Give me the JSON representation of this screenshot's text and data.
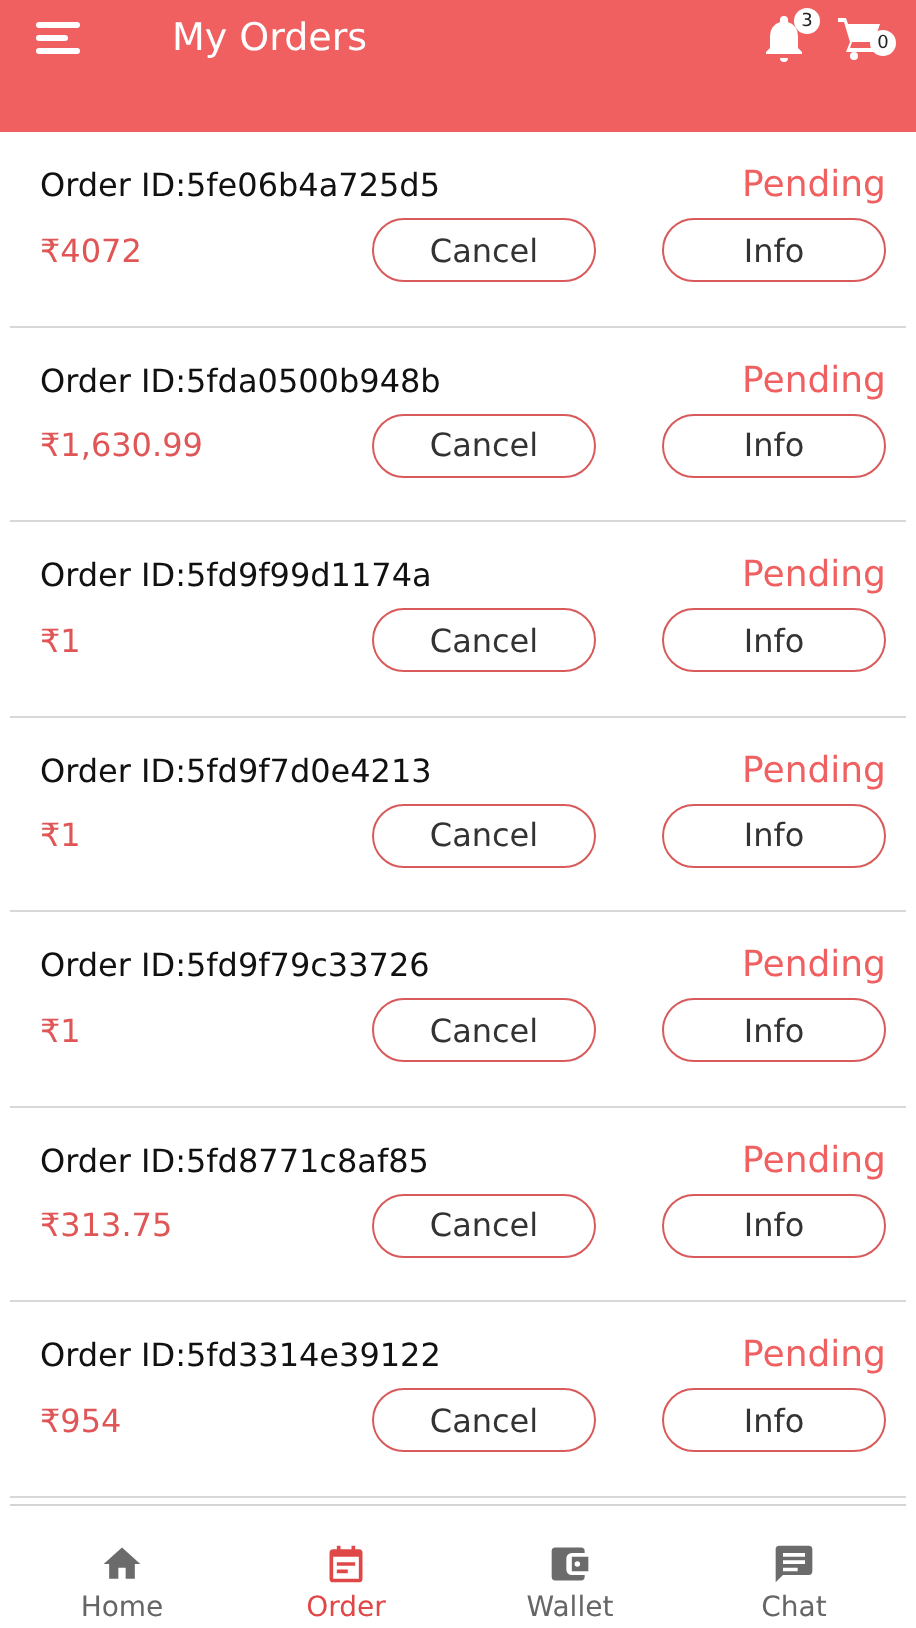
{
  "header": {
    "title": "My Orders",
    "notification_count": "3",
    "cart_count": "0"
  },
  "orders": [
    {
      "order_id": "Order ID:5fe06b4a725d5",
      "amount": "₹4072",
      "status": "Pending",
      "cancel_label": "Cancel",
      "info_label": "Info"
    },
    {
      "order_id": "Order ID:5fda0500b948b",
      "amount": "₹1,630.99",
      "status": "Pending",
      "cancel_label": "Cancel",
      "info_label": "Info"
    },
    {
      "order_id": "Order ID:5fd9f99d1174a",
      "amount": "₹1",
      "status": "Pending",
      "cancel_label": "Cancel",
      "info_label": "Info"
    },
    {
      "order_id": "Order ID:5fd9f7d0e4213",
      "amount": "₹1",
      "status": "Pending",
      "cancel_label": "Cancel",
      "info_label": "Info"
    },
    {
      "order_id": "Order ID:5fd9f79c33726",
      "amount": "₹1",
      "status": "Pending",
      "cancel_label": "Cancel",
      "info_label": "Info"
    },
    {
      "order_id": "Order ID:5fd8771c8af85",
      "amount": "₹313.75",
      "status": "Pending",
      "cancel_label": "Cancel",
      "info_label": "Info"
    },
    {
      "order_id": "Order ID:5fd3314e39122",
      "amount": "₹954",
      "status": "Pending",
      "cancel_label": "Cancel",
      "info_label": "Info"
    }
  ],
  "bottom_nav": [
    {
      "label": "Home",
      "kind": "home",
      "selected": false
    },
    {
      "label": "Order",
      "kind": "order",
      "selected": true
    },
    {
      "label": "Wallet",
      "kind": "wallet",
      "selected": false
    },
    {
      "label": "Chat",
      "kind": "chat",
      "selected": false
    }
  ]
}
